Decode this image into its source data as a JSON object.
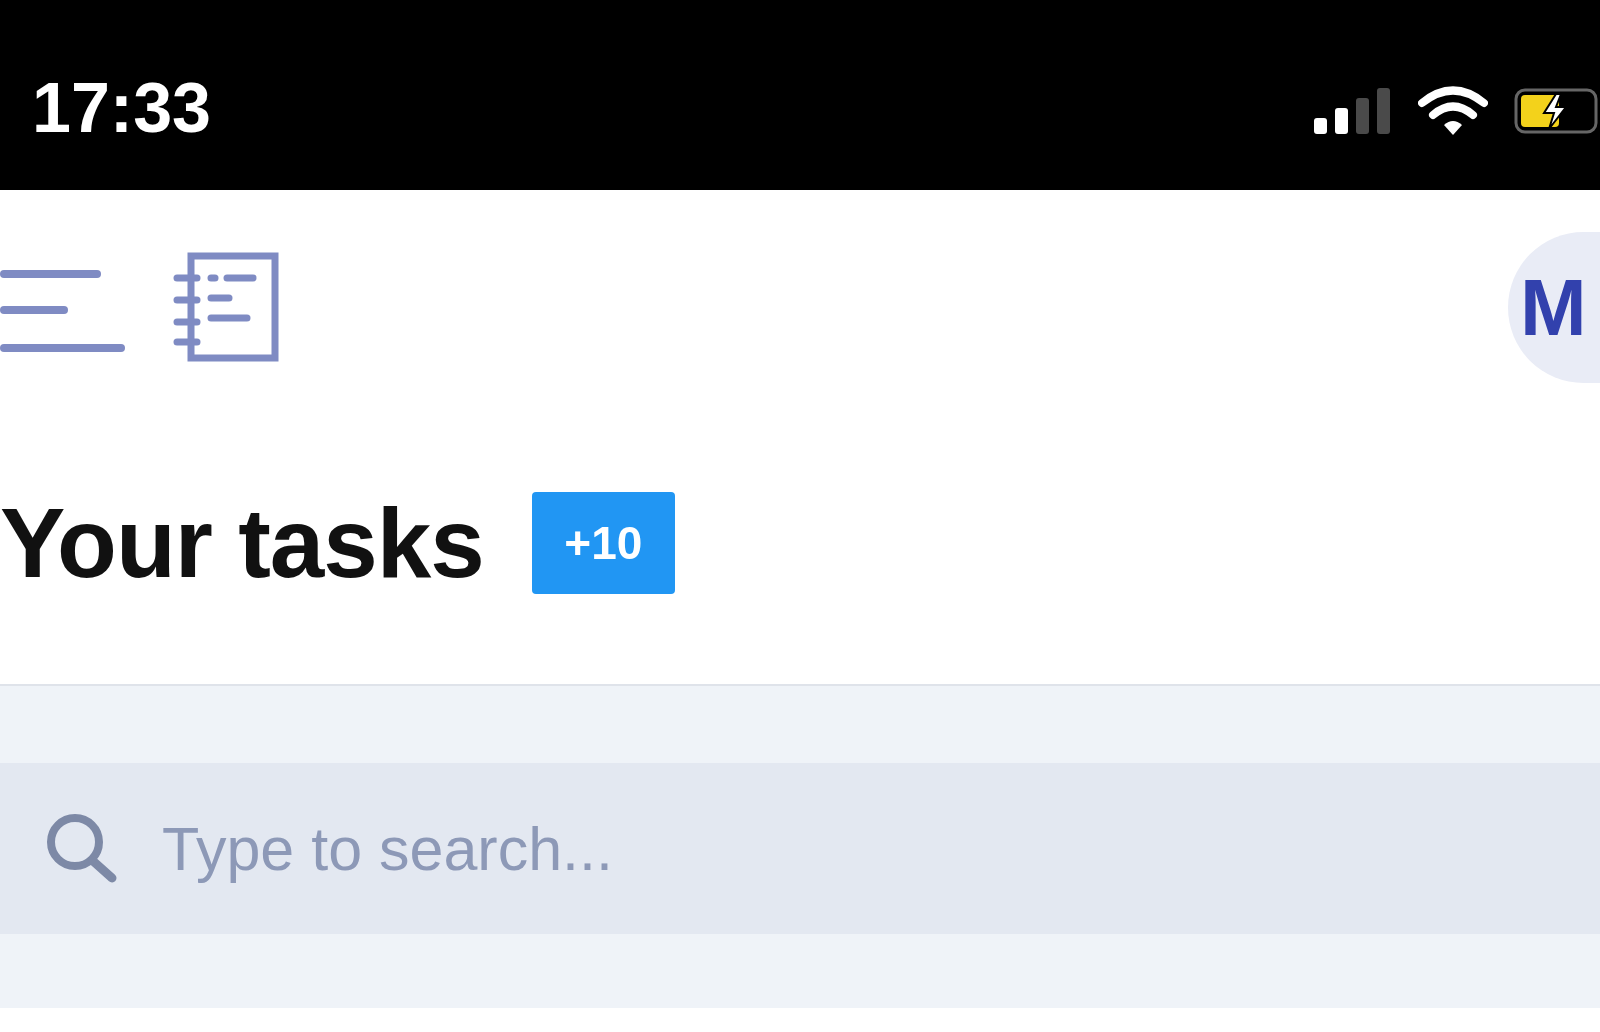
{
  "status_bar": {
    "time": "17:33"
  },
  "header": {
    "avatar": {
      "initials": "M"
    }
  },
  "heading": {
    "title": "Your tasks",
    "count_badge": "+10"
  },
  "search": {
    "placeholder": "Type to search..."
  }
}
